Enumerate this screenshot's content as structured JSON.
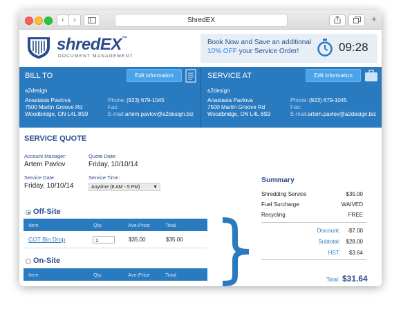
{
  "browser": {
    "title": "ShredEX",
    "back": "‹",
    "forward": "›",
    "colors": {
      "close": "#ff5f57",
      "minimize": "#febc2e",
      "maximize": "#28c840"
    }
  },
  "brand": {
    "name_a": "shred",
    "name_b": "EX",
    "tm": "™",
    "tagline": "DOCUMENT MANAGEMENT"
  },
  "promo": {
    "line1": "Book Now and Save an additional",
    "highlight": "10% OFF",
    "line2_rest": " your Service Order!",
    "timer": "09:28"
  },
  "bill_to": {
    "title": "BILL TO",
    "edit_label": "Edit information",
    "company": "a2design",
    "name": "Anastasia Pavlova",
    "street": "7500 Martin Groove Rd",
    "city": "Woodbridge, ON L4L 8S9",
    "phone_label": "Phone:",
    "phone": "(923) 679-1045",
    "fax_label": "Fax:",
    "email_label": "E-mail:",
    "email": "artem.pavlov@a2design.biz"
  },
  "service_at": {
    "title": "SERVICE AT",
    "edit_label": "Edit information",
    "company": "a2design",
    "name": "Anastasia Pavlova",
    "street": "7500 Martin Groove Rd",
    "city": "Woodbridge, ON L4L 8S9",
    "phone_label": "Phone:",
    "phone": "(923) 679-1045",
    "fax_label": "Fax:",
    "email_label": "E-mail:",
    "email": "artem.pavlov@a2design.biz"
  },
  "quote": {
    "title": "SERVICE QUOTE",
    "manager_label": "Account Manager:",
    "manager": "Artem Pavlov",
    "quote_date_label": "Quote Date:",
    "quote_date": "Friday, 10/10/14",
    "service_date_label": "Service Date:",
    "service_date": "Friday, 10/10/14",
    "service_time_label": "Service Time:",
    "service_time": "Anytime (8 AM - 5 PM)"
  },
  "offsite": {
    "title": "Off-Site",
    "columns": [
      "Item",
      "Qty.",
      "Ave.Price",
      "Total"
    ],
    "rows": [
      {
        "item": "COT Bin Drop",
        "qty": "1",
        "price": "$35.00",
        "total": "$35.00"
      }
    ]
  },
  "onsite": {
    "title": "On-Site",
    "columns": [
      "Item",
      "Qty.",
      "Ave.Price",
      "Total"
    ]
  },
  "summary": {
    "title": "Summary",
    "items": [
      {
        "label": "Shredding Service",
        "value": "$35.00"
      },
      {
        "label": "Fuel Surcharge",
        "value": "WAIVED"
      },
      {
        "label": "Recycling",
        "value": "FREE"
      }
    ],
    "discount_label": "Discount:",
    "discount": "-$7.00",
    "subtotal_label": "Subtotal:",
    "subtotal": "$28.00",
    "hst_label": "HST:",
    "hst": "$3.64",
    "total_label": "Total:",
    "total": "$31.64"
  }
}
